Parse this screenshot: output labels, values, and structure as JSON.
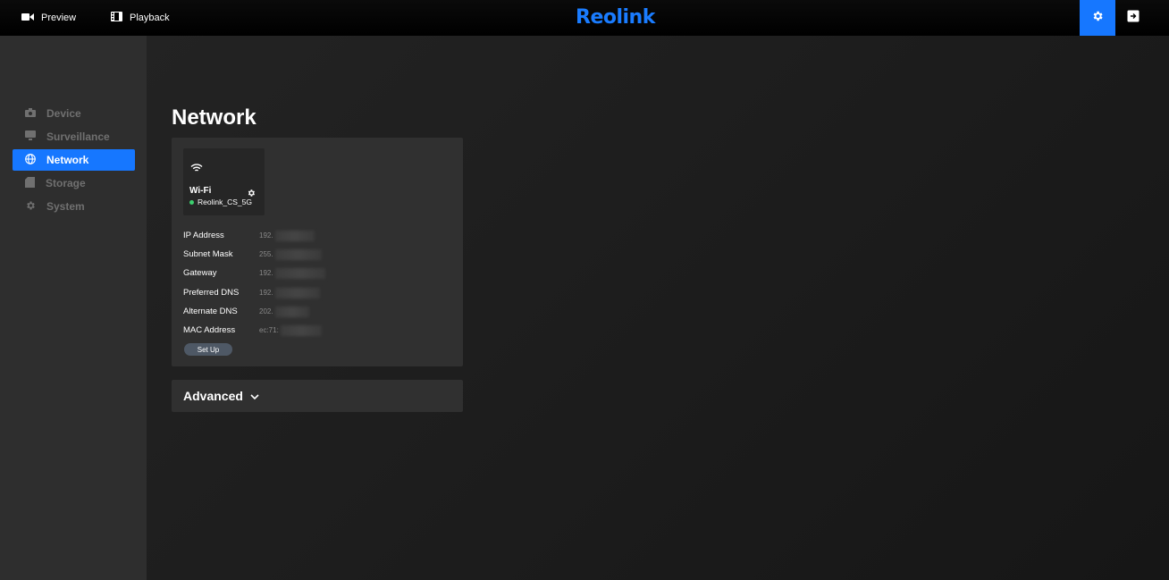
{
  "topbar": {
    "preview_label": "Preview",
    "playback_label": "Playback",
    "logo": "Reolink"
  },
  "sidebar": {
    "items": [
      {
        "label": "Device",
        "icon": "camera-icon"
      },
      {
        "label": "Surveillance",
        "icon": "monitor-icon"
      },
      {
        "label": "Network",
        "icon": "globe-icon",
        "active": true
      },
      {
        "label": "Storage",
        "icon": "storage-icon"
      },
      {
        "label": "System",
        "icon": "gear-icon"
      }
    ]
  },
  "main": {
    "title": "Network",
    "wifi": {
      "label": "Wi-Fi",
      "ssid": "Reolink_CS_5G",
      "status_color": "#3ccf6e"
    },
    "info": [
      {
        "label": "IP Address",
        "value": "192."
      },
      {
        "label": "Subnet Mask",
        "value": "255."
      },
      {
        "label": "Gateway",
        "value": "192."
      },
      {
        "label": "Preferred DNS",
        "value": "192."
      },
      {
        "label": "Alternate DNS",
        "value": "202."
      },
      {
        "label": "MAC Address",
        "value": "ec:71:"
      }
    ],
    "setup_label": "Set Up",
    "advanced_label": "Advanced"
  },
  "colors": {
    "accent": "#1677ff",
    "logo": "#1a7cff"
  }
}
